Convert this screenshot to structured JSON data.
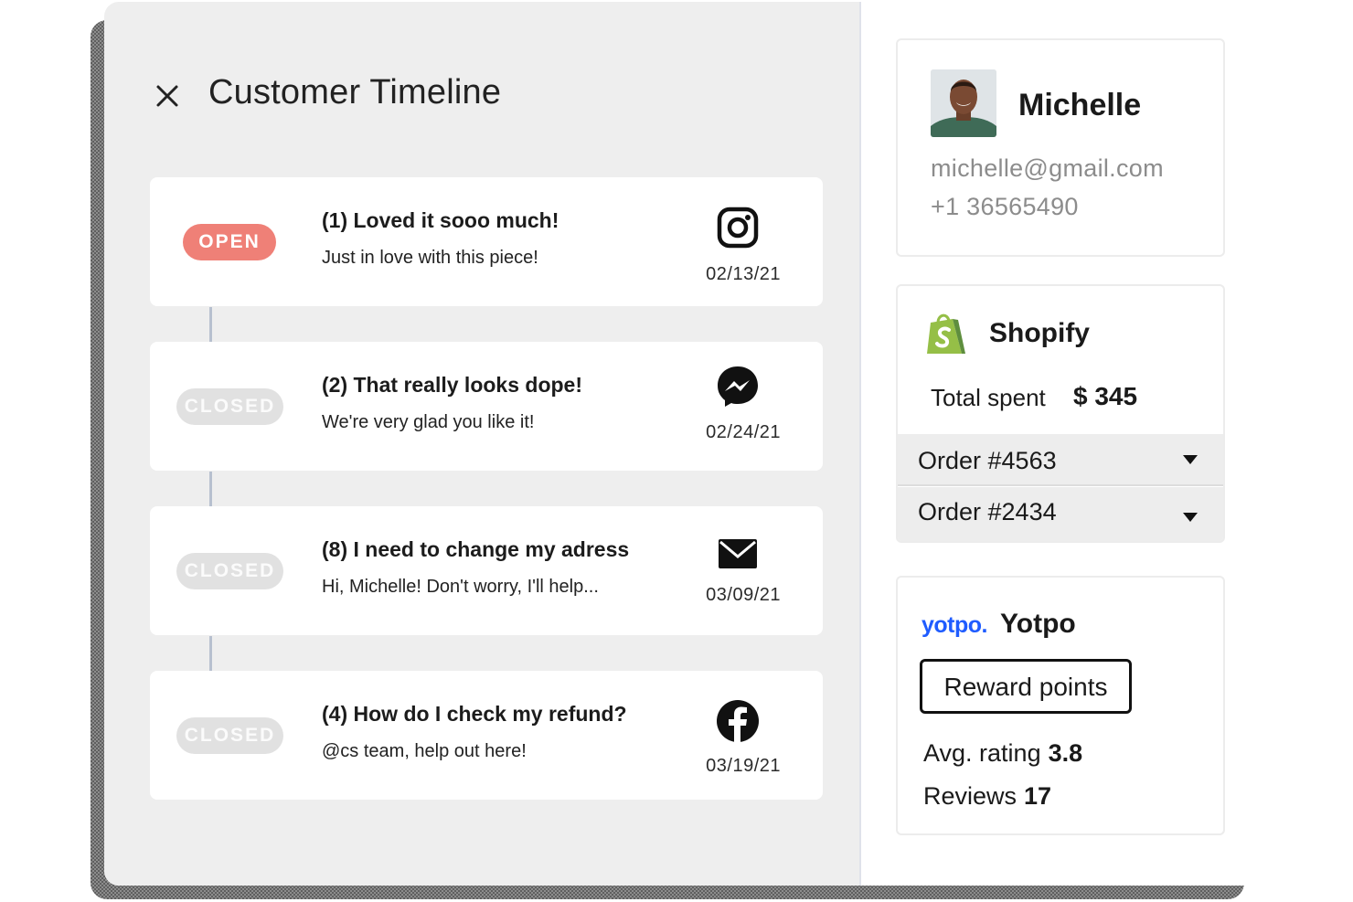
{
  "header": {
    "title": "Customer Timeline"
  },
  "tickets": [
    {
      "status": "OPEN",
      "title": "(1) Loved it sooo much!",
      "message": "Just in love with this piece!",
      "channel": "instagram-icon",
      "date": "02/13/21"
    },
    {
      "status": "CLOSED",
      "title": "(2) That really looks dope!",
      "message": "We're very glad you like it!",
      "channel": "messenger-icon",
      "date": "02/24/21"
    },
    {
      "status": "CLOSED",
      "title": "(8) I need to change my adress",
      "message": "Hi, Michelle! Don't worry, I'll help...",
      "channel": "email-icon",
      "date": "03/09/21"
    },
    {
      "status": "CLOSED",
      "title": "(4) How do I check my refund?",
      "message": "@cs team, help out here!",
      "channel": "facebook-icon",
      "date": "03/19/21"
    }
  ],
  "customer": {
    "name": "Michelle",
    "email": "michelle@gmail.com",
    "phone": "+1 36565490"
  },
  "shopify": {
    "name": "Shopify",
    "total_label": "Total spent",
    "total_value": "$ 345",
    "orders": [
      "Order #4563",
      "Order #2434"
    ]
  },
  "yotpo": {
    "logo_text": "yotpo.",
    "name": "Yotpo",
    "reward_label": "Reward points",
    "rating_label": "Avg. rating",
    "rating_value": "3.8",
    "reviews_label": "Reviews",
    "reviews_value": "17"
  },
  "colors": {
    "open_badge": "#ef8077",
    "closed_badge": "#e1e1e1",
    "shopify_green": "#95bf47",
    "yotpo_blue": "#1f5cff"
  }
}
